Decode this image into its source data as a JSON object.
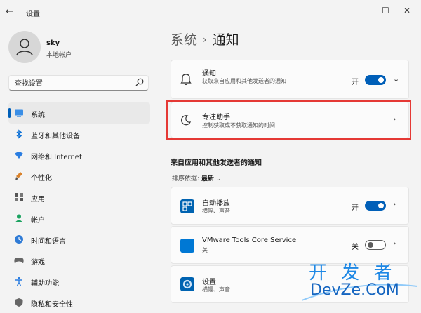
{
  "window": {
    "title": "设置",
    "controls": [
      "minimize",
      "maximize",
      "close"
    ]
  },
  "profile": {
    "name": "sky",
    "account_type": "本地帐户"
  },
  "search": {
    "placeholder": "查找设置"
  },
  "sidebar": {
    "items": [
      {
        "label": "系统",
        "icon": "monitor-icon",
        "active": true
      },
      {
        "label": "蓝牙和其他设备",
        "icon": "bluetooth-icon"
      },
      {
        "label": "网络和 Internet",
        "icon": "wifi-icon"
      },
      {
        "label": "个性化",
        "icon": "brush-icon"
      },
      {
        "label": "应用",
        "icon": "apps-icon"
      },
      {
        "label": "帐户",
        "icon": "person-icon"
      },
      {
        "label": "时间和语言",
        "icon": "clock-globe-icon"
      },
      {
        "label": "游戏",
        "icon": "gamepad-icon"
      },
      {
        "label": "辅助功能",
        "icon": "accessibility-icon"
      },
      {
        "label": "隐私和安全性",
        "icon": "shield-icon"
      }
    ]
  },
  "breadcrumb": {
    "parent": "系统",
    "separator": "›",
    "current": "通知"
  },
  "notifications": {
    "title": "通知",
    "subtitle": "获取来自应用和其他发送者的通知",
    "state_label": "开",
    "enabled": true
  },
  "focus_assist": {
    "title": "专注助手",
    "subtitle": "控制获取或不获取通知的时间"
  },
  "apps_section": {
    "title": "来自应用和其他发送者的通知",
    "sort_label": "排序依据:",
    "sort_value": "最新",
    "apps": [
      {
        "name": "自动播放",
        "detail": "横幅、声音",
        "state_label": "开",
        "enabled": true,
        "icon": "autoplay-icon",
        "color": "#0063b1"
      },
      {
        "name": "VMware Tools Core Service",
        "detail": "关",
        "state_label": "关",
        "enabled": false,
        "icon": "vmware-icon",
        "color": "#0078d4"
      },
      {
        "name": "设置",
        "detail": "横幅、声音",
        "icon": "settings-gear-icon",
        "color": "#0063b1"
      }
    ]
  },
  "colors": {
    "accent": "#005fb8",
    "highlight_border": "#e53935"
  },
  "watermark": {
    "cn": "开 发 者",
    "en": "DevZe.CoM"
  }
}
